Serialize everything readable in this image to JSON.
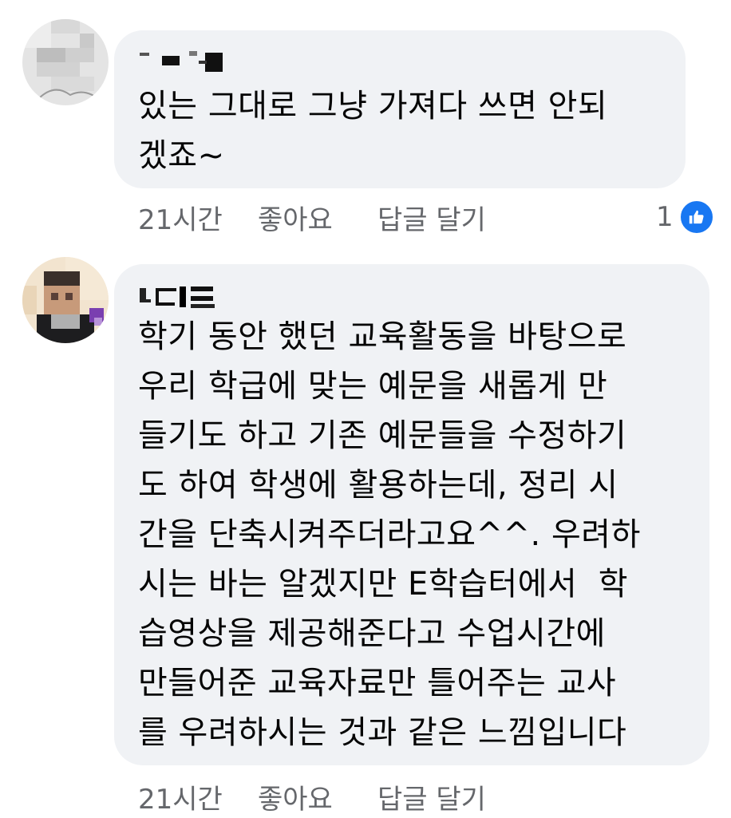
{
  "comments": [
    {
      "text": "있는 그대로 그냥 가져다 쓰면 안되\n겠죠~",
      "time": "21시간",
      "like_label": "좋아요",
      "reply_label": "답글 달기",
      "reaction_count": "1",
      "reaction_icon": "thumbs-up-icon"
    },
    {
      "text": "학기 동안 했던 교육활동을 바탕으로\n우리 학급에 맞는 예문을 새롭게 만\n들기도 하고 기존 예문들을 수정하기\n도 하여 학생에 활용하는데, 정리 시\n간을 단축시켜주더라고요^^. 우려하\n시는 바는 알겠지만 E학습터에서  학\n습영상을 제공해준다고 수업시간에\n만들어준 교육자료만 틀어주는 교사\n를 우려하시는 것과 같은 느낌입니다",
      "time": "21시간",
      "like_label": "좋아요",
      "reply_label": "답글 달기"
    }
  ],
  "colors": {
    "bubble": "#f0f2f5",
    "meta_text": "#65676b",
    "like_blue": "#1877f2"
  }
}
